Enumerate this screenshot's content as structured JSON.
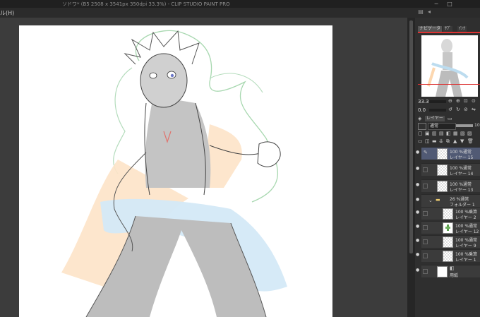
{
  "titlebar": {
    "title": "ソドワ* (B5 2508 x 3541px 350dpi 33.3%) - CLIP STUDIO PAINT PRO",
    "minimize": "─",
    "maximize": "□"
  },
  "menubar": {
    "last_menu": "ル(H)"
  },
  "panel": {
    "tabs": {
      "navigator": "ナビゲータ",
      "tab2": "ｻﾌﾞ",
      "tab3": "ｲﾝｸ"
    },
    "zoom_value": "33.3",
    "angle_value": "0.0",
    "layer_tab": "レイヤー",
    "blend_mode": "通常",
    "opacity_value": "100"
  },
  "layers": [
    {
      "mode": "100 %通常",
      "name": "レイヤー 15",
      "selected": true,
      "indent": 0
    },
    {
      "mode": "100 %通常",
      "name": "レイヤー 14",
      "selected": false,
      "indent": 0
    },
    {
      "mode": "100 %通常",
      "name": "レイヤー 13",
      "selected": false,
      "indent": 0
    },
    {
      "mode": "26 %通常",
      "name": "フォルダー 1",
      "selected": false,
      "indent": 0,
      "folder": true
    },
    {
      "mode": "100 %乗算",
      "name": "レイヤー 2",
      "selected": false,
      "indent": 1
    },
    {
      "mode": "100 %通常",
      "name": "レイヤー 12",
      "selected": false,
      "indent": 1
    },
    {
      "mode": "100 %通常",
      "name": "レイヤー 9",
      "selected": false,
      "indent": 1
    },
    {
      "mode": "100 %乗算",
      "name": "レイヤー 1",
      "selected": false,
      "indent": 1
    },
    {
      "mode": "",
      "name": "用紙",
      "selected": false,
      "indent": 0,
      "paper": true
    }
  ]
}
